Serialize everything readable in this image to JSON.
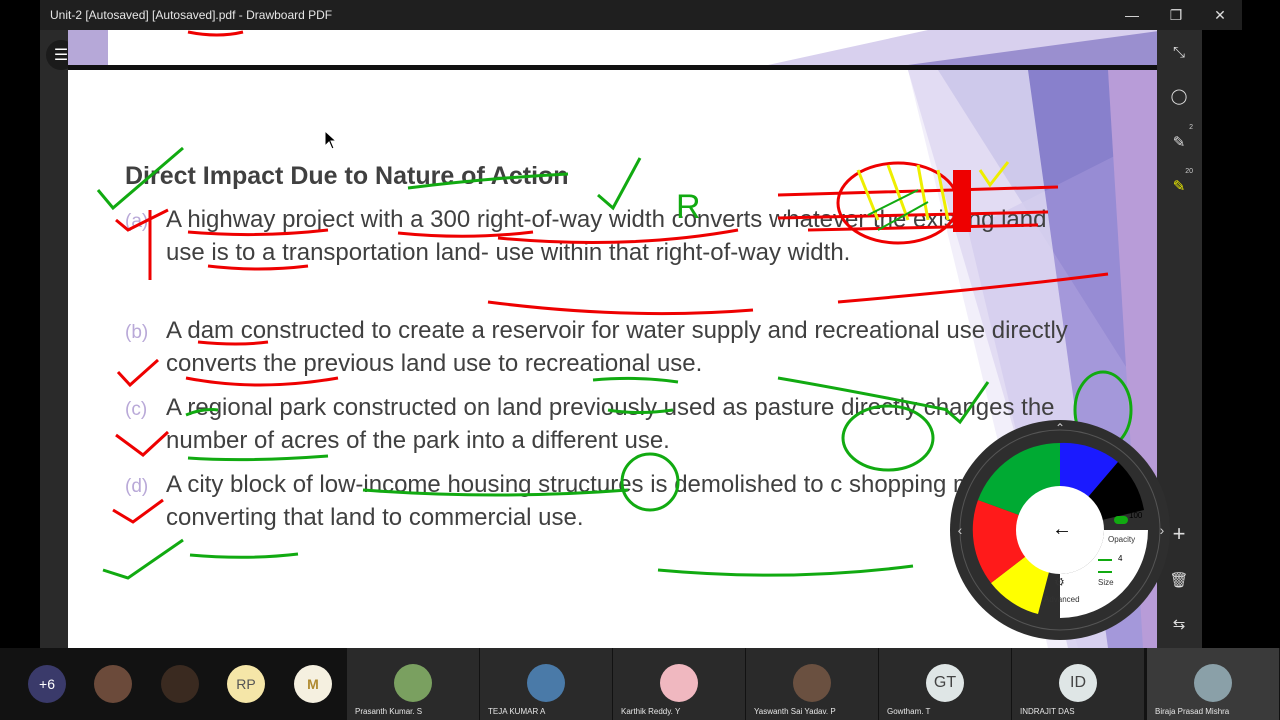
{
  "window": {
    "title": "Unit-2 [Autosaved] [Autosaved].pdf - Drawboard PDF",
    "minimize_icon": "—",
    "restore_icon": "❐",
    "close_icon": "✕"
  },
  "slide": {
    "heading": "Direct Impact Due to Nature of Action",
    "items": [
      {
        "mark": "(a)",
        "text": "A highway project with a 300 right-of-way width converts whatever the existing land use is to a transportation land- use within that right-of-way width."
      },
      {
        "mark": "(b)",
        "text": "A dam constructed to create a reservoir for water supply and recreational use directly converts the previous land use to recreational use."
      },
      {
        "mark": "(c)",
        "text": "A regional park constructed on land previously used as pasture directly changes the number of acres of the park into a different use."
      },
      {
        "mark": "(d)",
        "text": "A city block of low-income housing structures is demolished to c shopping mall, directly converting that land to commercial use."
      }
    ],
    "annotations": {
      "letter": "R"
    }
  },
  "right_toolbar": {
    "pen_count": "2",
    "highlighter_count": "20"
  },
  "color_wheel": {
    "opacity_value": "100",
    "opacity_label": "Opacity",
    "size_value": "4",
    "size_label": "Size",
    "advanced_label": "Advanced",
    "back_arrow": "←",
    "colors": [
      "#1a1aff",
      "#000000",
      "#ffff00",
      "#ff1a1a",
      "#00aa33"
    ]
  },
  "participants": {
    "more_count": "+6",
    "small": [
      {
        "initials": "",
        "color": "#6b4a3a"
      },
      {
        "initials": "",
        "color": "#3a2a20"
      },
      {
        "initials": "RP",
        "color": "#f5e6a8"
      },
      {
        "initials": "",
        "color": "#f5f0e0"
      }
    ],
    "tiles": [
      {
        "name": "Prasanth Kumar. S",
        "initials": "",
        "color": "#7aa060"
      },
      {
        "name": "TEJA KUMAR A",
        "initials": "",
        "color": "#4a7aa8"
      },
      {
        "name": "Karthik Reddy. Y",
        "initials": "",
        "color": "#f0b8c0"
      },
      {
        "name": "Yaswanth Sai Yadav. P",
        "initials": "",
        "color": "#6a5040"
      },
      {
        "name": "Gowtham. T",
        "initials": "GT",
        "color": "#dfe6e6"
      },
      {
        "name": "INDRAJIT DAS",
        "initials": "ID",
        "color": "#dfe6e6"
      },
      {
        "name": "Biraja Prasad Mishra",
        "initials": "",
        "color": "#8aa0a8"
      }
    ]
  }
}
